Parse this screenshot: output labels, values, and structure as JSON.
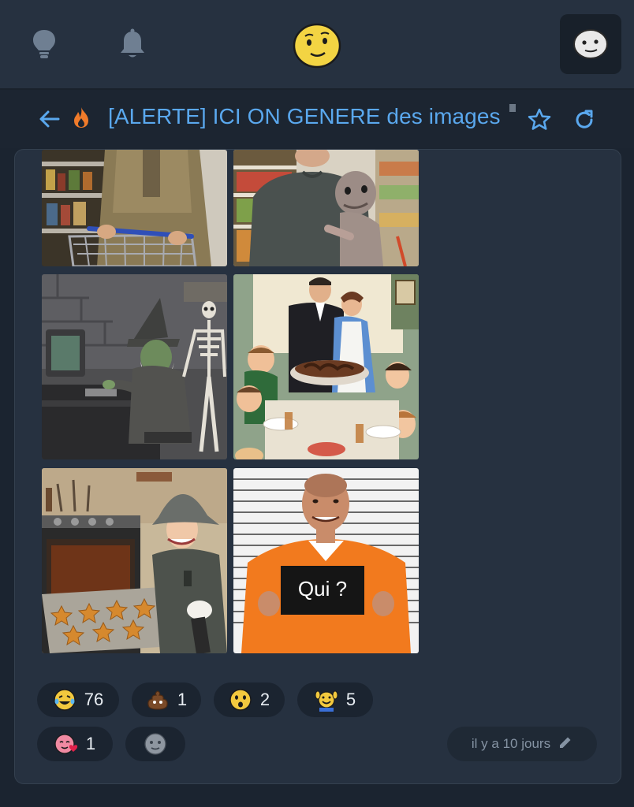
{
  "topbar": {
    "icons": [
      "lightbulb-icon",
      "bell-icon",
      "smiley-logo-icon",
      "avatar-icon"
    ]
  },
  "topic": {
    "title": "[ALERTE] ICI ON GENERE des images",
    "icons": [
      "back-arrow-icon",
      "fire-icon",
      "star-icon",
      "refresh-icon"
    ]
  },
  "images": [
    {
      "name": "man-with-shopping-cart-image"
    },
    {
      "name": "man-holding-alien-image"
    },
    {
      "name": "wizard-at-computer-image"
    },
    {
      "name": "family-dinner-image"
    },
    {
      "name": "soldier-woman-oven-image"
    },
    {
      "name": "mugshot-image",
      "sign_text": "Qui ?"
    }
  ],
  "reactions": [
    {
      "emoji": "laughing-tears-icon",
      "count": "76"
    },
    {
      "emoji": "poop-icon",
      "count": "1"
    },
    {
      "emoji": "surprised-face-icon",
      "count": "2"
    },
    {
      "emoji": "raising-hands-icon",
      "count": "5"
    },
    {
      "emoji": "heart-face-icon",
      "count": "1"
    },
    {
      "emoji": "add-reaction-icon",
      "count": ""
    }
  ],
  "post": {
    "timestamp": "il y a 10 jours",
    "edit_icon": "pencil-icon"
  },
  "colors": {
    "accent": "#5aa8ee",
    "background": "#1b2430",
    "card": "#263140",
    "fire": "#f07b2a"
  }
}
